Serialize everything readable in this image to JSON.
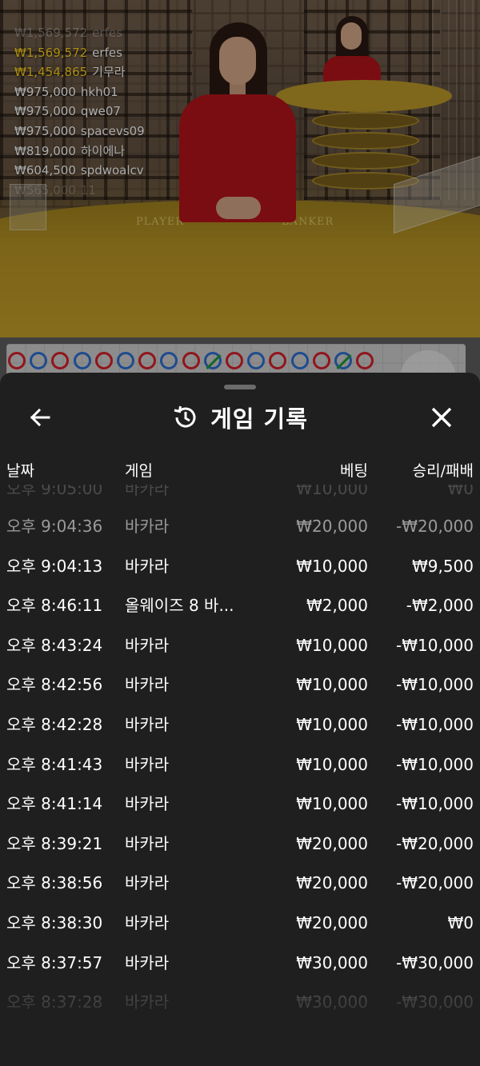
{
  "live": {
    "table_labels": [
      "PLAYER",
      "BANKER"
    ],
    "winners": [
      {
        "amount": "₩1,569,572",
        "name": "erfes",
        "style": "fade1"
      },
      {
        "amount": "₩1,569,572",
        "name": "erfes",
        "style": "gold"
      },
      {
        "amount": "₩1,454,865",
        "name": "기무라",
        "style": "gold"
      },
      {
        "amount": "₩975,000",
        "name": "hkh01",
        "style": ""
      },
      {
        "amount": "₩975,000",
        "name": "qwe07",
        "style": ""
      },
      {
        "amount": "₩975,000",
        "name": "spacevs09",
        "style": ""
      },
      {
        "amount": "₩819,000",
        "name": "하이에나",
        "style": ""
      },
      {
        "amount": "₩604,500",
        "name": "spdwoalcv",
        "style": ""
      },
      {
        "amount": "₩565,000",
        "name": "11",
        "style": "fade2"
      }
    ]
  },
  "roadmap": {
    "beads": [
      "r",
      "b",
      "r",
      "b",
      "r",
      "b",
      "r",
      "b",
      "r",
      "t",
      "r",
      "b",
      "r",
      "b",
      "r",
      "t",
      "r"
    ],
    "colors": {
      "banker": "#d41f2a",
      "player": "#2d6fd1",
      "tie": "#1c9a3a"
    }
  },
  "history": {
    "title": "게임 기록",
    "icons": {
      "back": "arrow-left-icon",
      "history": "history-clock-icon",
      "close": "close-icon"
    },
    "columns": {
      "date": "날짜",
      "game": "게임",
      "bet": "베팅",
      "result": "승리/패배"
    },
    "partial_top": {
      "date": "오후 9:05:00",
      "game": "바카라",
      "bet": "₩10,000",
      "result": "₩0"
    },
    "rows": [
      {
        "date": "오후 9:04:36",
        "game": "바카라",
        "bet": "₩20,000",
        "result": "-₩20,000",
        "tone": "dim"
      },
      {
        "date": "오후 9:04:13",
        "game": "바카라",
        "bet": "₩10,000",
        "result": "₩9,500",
        "tone": ""
      },
      {
        "date": "오후 8:46:11",
        "game": "올웨이즈 8 바...",
        "bet": "₩2,000",
        "result": "-₩2,000",
        "tone": ""
      },
      {
        "date": "오후 8:43:24",
        "game": "바카라",
        "bet": "₩10,000",
        "result": "-₩10,000",
        "tone": ""
      },
      {
        "date": "오후 8:42:56",
        "game": "바카라",
        "bet": "₩10,000",
        "result": "-₩10,000",
        "tone": ""
      },
      {
        "date": "오후 8:42:28",
        "game": "바카라",
        "bet": "₩10,000",
        "result": "-₩10,000",
        "tone": ""
      },
      {
        "date": "오후 8:41:43",
        "game": "바카라",
        "bet": "₩10,000",
        "result": "-₩10,000",
        "tone": ""
      },
      {
        "date": "오후 8:41:14",
        "game": "바카라",
        "bet": "₩10,000",
        "result": "-₩10,000",
        "tone": ""
      },
      {
        "date": "오후 8:39:21",
        "game": "바카라",
        "bet": "₩20,000",
        "result": "-₩20,000",
        "tone": ""
      },
      {
        "date": "오후 8:38:56",
        "game": "바카라",
        "bet": "₩20,000",
        "result": "-₩20,000",
        "tone": ""
      },
      {
        "date": "오후 8:38:30",
        "game": "바카라",
        "bet": "₩20,000",
        "result": "₩0",
        "tone": ""
      },
      {
        "date": "오후 8:37:57",
        "game": "바카라",
        "bet": "₩30,000",
        "result": "-₩30,000",
        "tone": ""
      },
      {
        "date": "오후 8:37:28",
        "game": "바카라",
        "bet": "₩30,000",
        "result": "-₩30,000",
        "tone": "faint"
      }
    ]
  }
}
